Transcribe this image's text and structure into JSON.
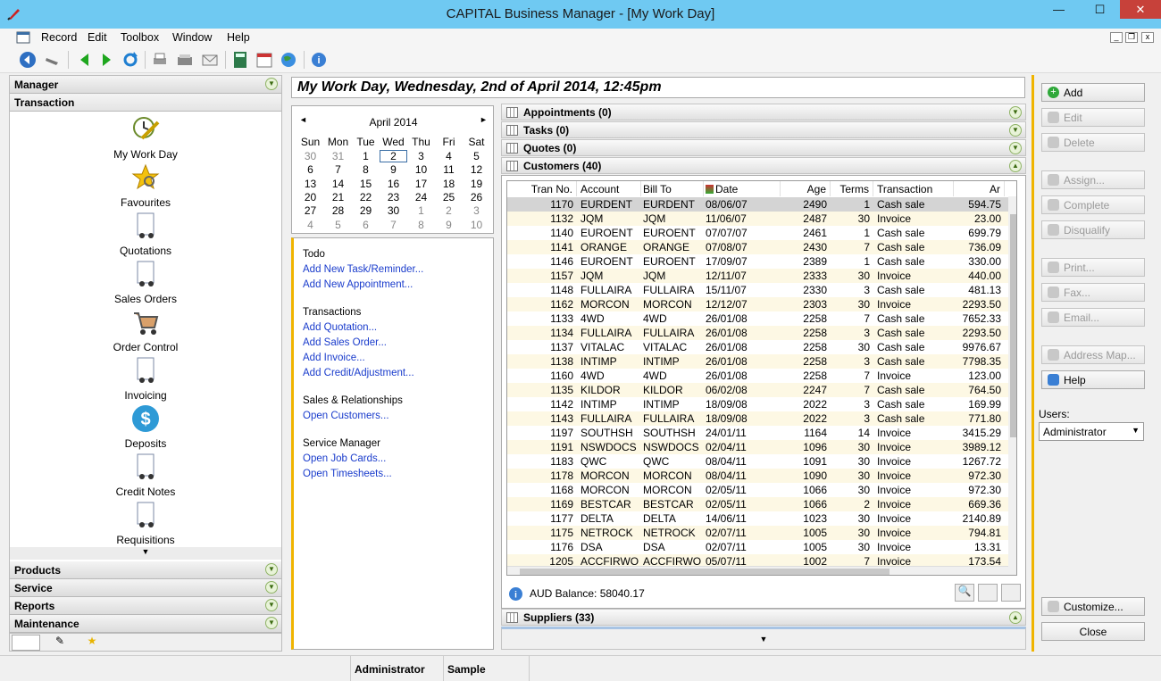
{
  "window": {
    "title": "CAPITAL Business Manager - [My Work Day]",
    "minimize": "—",
    "maximize": "☐",
    "close": "✕"
  },
  "menu": [
    "Record",
    "Edit",
    "Toolbox",
    "Window",
    "Help"
  ],
  "left_panel": {
    "sections_top": [
      "Manager",
      "Transaction"
    ],
    "nav_items": [
      "My Work Day",
      "Favourites",
      "Quotations",
      "Sales Orders",
      "Order Control",
      "Invoicing",
      "Deposits",
      "Credit Notes",
      "Requisitions"
    ],
    "sections_bottom": [
      "Products",
      "Service",
      "Reports",
      "Maintenance"
    ]
  },
  "date_header": "My Work Day, Wednesday, 2nd of April 2014, 12:45pm",
  "calendar": {
    "month": "April 2014",
    "weekdays": [
      "Sun",
      "Mon",
      "Tue",
      "Wed",
      "Thu",
      "Fri",
      "Sat"
    ],
    "weeks": [
      [
        "30",
        "31",
        "1",
        "2",
        "3",
        "4",
        "5"
      ],
      [
        "6",
        "7",
        "8",
        "9",
        "10",
        "11",
        "12"
      ],
      [
        "13",
        "14",
        "15",
        "16",
        "17",
        "18",
        "19"
      ],
      [
        "20",
        "21",
        "22",
        "23",
        "24",
        "25",
        "26"
      ],
      [
        "27",
        "28",
        "29",
        "30",
        "1",
        "2",
        "3"
      ],
      [
        "4",
        "5",
        "6",
        "7",
        "8",
        "9",
        "10"
      ]
    ],
    "selected": "2"
  },
  "todo_panel": {
    "groups": [
      {
        "heading": "Todo",
        "links": [
          "Add New Task/Reminder...",
          "Add New Appointment..."
        ]
      },
      {
        "heading": "Transactions",
        "links": [
          "Add Quotation...",
          "Add Sales Order...",
          "Add Invoice...",
          "Add Credit/Adjustment..."
        ]
      },
      {
        "heading": "Sales & Relationships",
        "links": [
          "Open Customers..."
        ]
      },
      {
        "heading": "Service Manager",
        "links": [
          "Open Job Cards...",
          "Open Timesheets..."
        ]
      }
    ]
  },
  "sections": {
    "appointments": "Appointments (0)",
    "tasks": "Tasks (0)",
    "quotes": "Quotes (0)",
    "customers": "Customers (40)",
    "suppliers": "Suppliers (33)"
  },
  "grid": {
    "columns": [
      "Tran No.",
      "Account",
      "Bill To",
      "Date",
      "Age",
      "Terms",
      "Transaction",
      "Ar"
    ],
    "rows": [
      [
        "1170",
        "EURDENT",
        "EURDENT",
        "08/06/07",
        "2490",
        "1",
        "Cash sale",
        "594.75"
      ],
      [
        "1132",
        "JQM",
        "JQM",
        "11/06/07",
        "2487",
        "30",
        "Invoice",
        "23.00"
      ],
      [
        "1140",
        "EUROENT",
        "EUROENT",
        "07/07/07",
        "2461",
        "1",
        "Cash sale",
        "699.79"
      ],
      [
        "1141",
        "ORANGE",
        "ORANGE",
        "07/08/07",
        "2430",
        "7",
        "Cash sale",
        "736.09"
      ],
      [
        "1146",
        "EUROENT",
        "EUROENT",
        "17/09/07",
        "2389",
        "1",
        "Cash sale",
        "330.00"
      ],
      [
        "1157",
        "JQM",
        "JQM",
        "12/11/07",
        "2333",
        "30",
        "Invoice",
        "440.00"
      ],
      [
        "1148",
        "FULLAIRA",
        "FULLAIRA",
        "15/11/07",
        "2330",
        "3",
        "Cash sale",
        "481.13"
      ],
      [
        "1162",
        "MORCON",
        "MORCON",
        "12/12/07",
        "2303",
        "30",
        "Invoice",
        "2293.50"
      ],
      [
        "1133",
        "4WD",
        "4WD",
        "26/01/08",
        "2258",
        "7",
        "Cash sale",
        "7652.33"
      ],
      [
        "1134",
        "FULLAIRA",
        "FULLAIRA",
        "26/01/08",
        "2258",
        "3",
        "Cash sale",
        "2293.50"
      ],
      [
        "1137",
        "VITALAC",
        "VITALAC",
        "26/01/08",
        "2258",
        "30",
        "Cash sale",
        "9976.67"
      ],
      [
        "1138",
        "INTIMP",
        "INTIMP",
        "26/01/08",
        "2258",
        "3",
        "Cash sale",
        "7798.35"
      ],
      [
        "1160",
        "4WD",
        "4WD",
        "26/01/08",
        "2258",
        "7",
        "Invoice",
        "123.00"
      ],
      [
        "1135",
        "KILDOR",
        "KILDOR",
        "06/02/08",
        "2247",
        "7",
        "Cash sale",
        "764.50"
      ],
      [
        "1142",
        "INTIMP",
        "INTIMP",
        "18/09/08",
        "2022",
        "3",
        "Cash sale",
        "169.99"
      ],
      [
        "1143",
        "FULLAIRA",
        "FULLAIRA",
        "18/09/08",
        "2022",
        "3",
        "Cash sale",
        "771.80"
      ],
      [
        "1197",
        "SOUTHSH",
        "SOUTHSH",
        "24/01/11",
        "1164",
        "14",
        "Invoice",
        "3415.29"
      ],
      [
        "1191",
        "NSWDOCS",
        "NSWDOCS",
        "02/04/11",
        "1096",
        "30",
        "Invoice",
        "3989.12"
      ],
      [
        "1183",
        "QWC",
        "QWC",
        "08/04/11",
        "1091",
        "30",
        "Invoice",
        "1267.72"
      ],
      [
        "1178",
        "MORCON",
        "MORCON",
        "08/04/11",
        "1090",
        "30",
        "Invoice",
        "972.30"
      ],
      [
        "1168",
        "MORCON",
        "MORCON",
        "02/05/11",
        "1066",
        "30",
        "Invoice",
        "972.30"
      ],
      [
        "1169",
        "BESTCAR",
        "BESTCAR",
        "02/05/11",
        "1066",
        "2",
        "Invoice",
        "669.36"
      ],
      [
        "1177",
        "DELTA",
        "DELTA",
        "14/06/11",
        "1023",
        "30",
        "Invoice",
        "2140.89"
      ],
      [
        "1175",
        "NETROCK",
        "NETROCK",
        "02/07/11",
        "1005",
        "30",
        "Invoice",
        "794.81"
      ],
      [
        "1176",
        "DSA",
        "DSA",
        "02/07/11",
        "1005",
        "30",
        "Invoice",
        "13.31"
      ],
      [
        "1205",
        "ACCFIRWO",
        "ACCFIRWO",
        "05/07/11",
        "1002",
        "7",
        "Invoice",
        "173.54"
      ]
    ],
    "selected_row": 0
  },
  "balance": "AUD Balance: 58040.17",
  "right_panel": {
    "buttons": [
      {
        "label": "Add",
        "enabled": true
      },
      {
        "label": "Edit",
        "enabled": false
      },
      {
        "label": "Delete",
        "enabled": false
      },
      {
        "label": "Assign...",
        "enabled": false
      },
      {
        "label": "Complete",
        "enabled": false
      },
      {
        "label": "Disqualify",
        "enabled": false
      },
      {
        "label": "Print...",
        "enabled": false
      },
      {
        "label": "Fax...",
        "enabled": false
      },
      {
        "label": "Email...",
        "enabled": false
      },
      {
        "label": "Address Map...",
        "enabled": false
      },
      {
        "label": "Help",
        "enabled": true
      }
    ],
    "users_label": "Users:",
    "users_value": "Administrator",
    "customize": "Customize...",
    "close": "Close"
  },
  "status": {
    "user": "Administrator",
    "company": "Sample"
  },
  "colors": {
    "titlebar": "#6fc9f2",
    "accent": "#f0b400",
    "link": "#1a3ccc",
    "close_button": "#c7413a"
  }
}
